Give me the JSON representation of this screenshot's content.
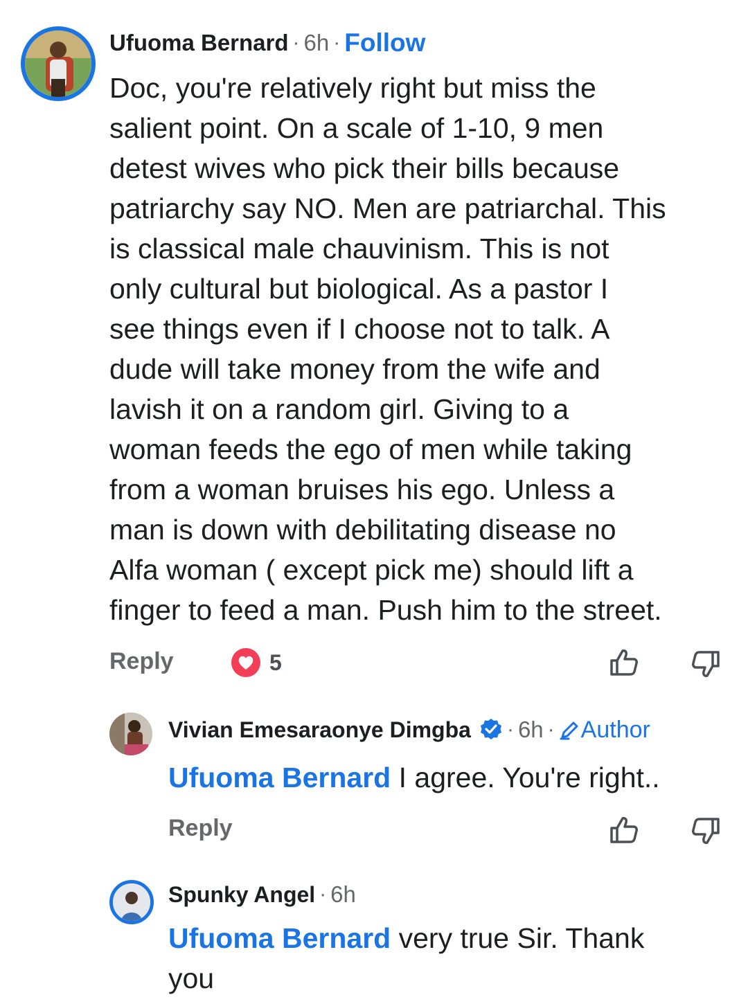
{
  "comment": {
    "author": "Ufuoma Bernard",
    "time": "6h",
    "follow_label": "Follow",
    "text": "Doc, you're relatively right but miss the\nsalient point. On a scale of 1-10, 9 men\ndetest wives who pick their bills because\npatriarchy say NO. Men are patriarchal. This\nis classical male chauvinism. This is not\nonly cultural but biological. As a pastor I\nsee things even if I choose not to talk. A\ndude will take money from the wife and\nlavish it on a random girl. Giving to a\nwoman feeds the ego of men while taking\nfrom a woman bruises his ego. Unless a\nman is down with debilitating disease no\nAlfa woman ( except pick me) should lift a\nfinger to feed a man. Push him to the street.",
    "reply_label": "Reply",
    "reaction_icon": "heart-icon",
    "reaction_count": "5",
    "like_icon": "thumbs-up-icon",
    "dislike_icon": "thumbs-down-icon"
  },
  "replies": [
    {
      "author": "Vivian Emesaraonye Dimgba",
      "verified_icon": "verified-badge-icon",
      "time": "6h",
      "author_badge": "Author",
      "author_badge_icon": "pencil-icon",
      "mention": "Ufuoma Bernard",
      "text": " I agree. You're right..",
      "reply_label": "Reply"
    },
    {
      "author": "Spunky Angel",
      "time": "6h",
      "mention": "Ufuoma Bernard",
      "text": " very true Sir. Thank\nyou"
    }
  ],
  "colors": {
    "accent": "#1b74e4",
    "text": "#1c1e21",
    "muted": "#65676b",
    "heart": "#f33e58"
  }
}
